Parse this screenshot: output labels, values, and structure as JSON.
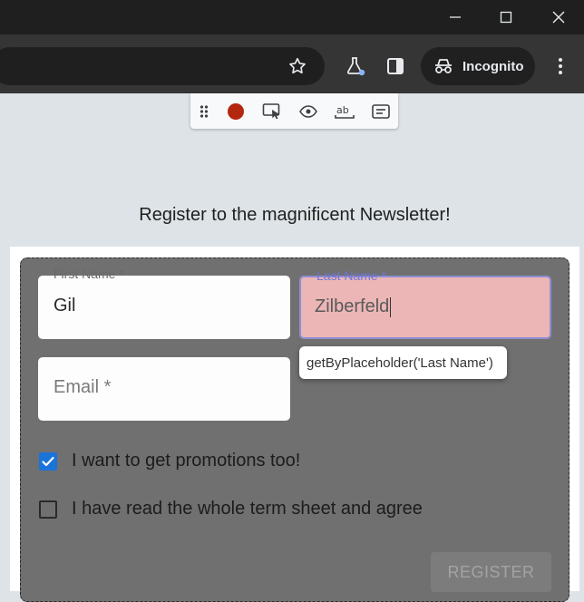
{
  "window": {
    "minimize_icon": "minimize-icon",
    "maximize_icon": "maximize-icon",
    "close_icon": "close-icon"
  },
  "toolbar": {
    "bookmark_icon": "star-icon",
    "labs_icon": "flask-icon",
    "side_panel_icon": "side-panel-icon",
    "incognito_label": "Incognito",
    "menu_icon": "kebab-menu-icon"
  },
  "recorder_toolbar": {
    "items": [
      "drag-handle-icon",
      "record-icon",
      "pick-locator-icon",
      "assert-visibility-icon",
      "assert-text-icon",
      "assert-value-icon"
    ],
    "record_color": "#b3260f"
  },
  "page": {
    "heading": "Register to the magnificent Newsletter!"
  },
  "form": {
    "first_name_label": "First Name *",
    "first_name_value": "Gil",
    "last_name_label": "Last Name *",
    "last_name_value": "Zilberfeld",
    "email_placeholder": "Email *",
    "promotions_label": "I want to get promotions too!",
    "promotions_checked": true,
    "terms_label": "I have read the whole term sheet and agree",
    "terms_checked": false,
    "register_label": "REGISTER"
  },
  "tooltip": {
    "text": "getByPlaceholder('Last Name')"
  },
  "colors": {
    "highlight_fill": "#ecb6b6",
    "highlight_border": "#8e8ed4",
    "checkbox_accent": "#1a73d9"
  }
}
